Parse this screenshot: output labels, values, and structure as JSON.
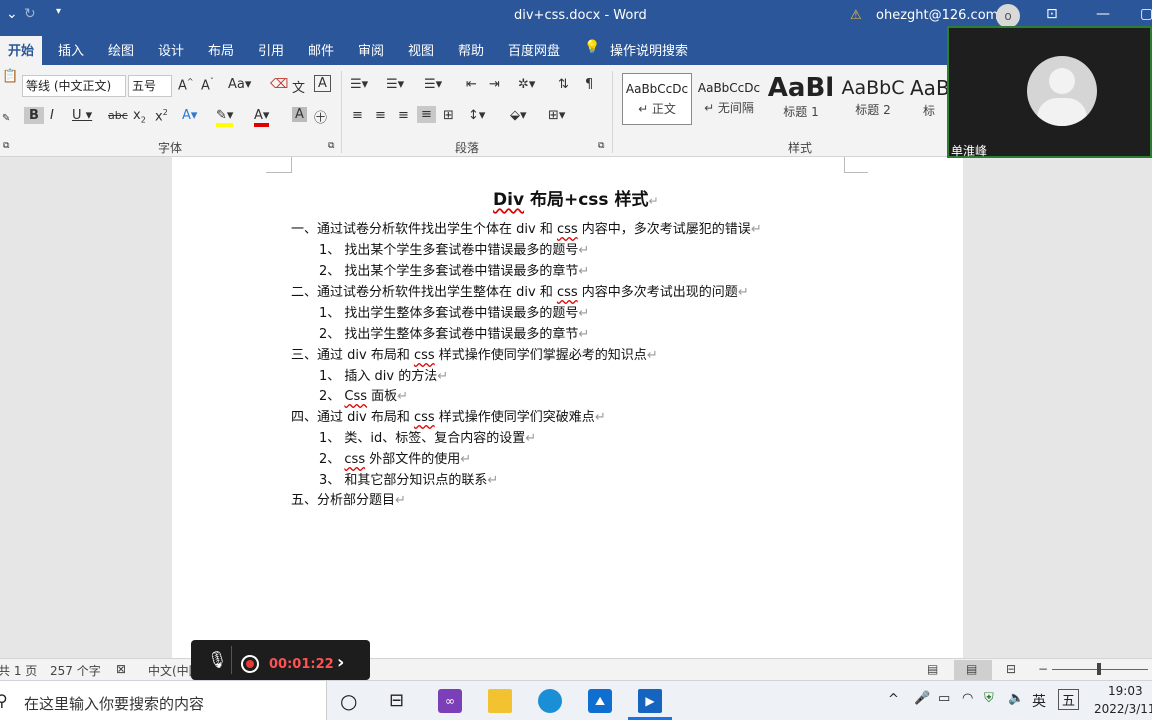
{
  "window": {
    "title": "div+css.docx  -  Word",
    "warning_icon": "warning-icon",
    "account": "ohezght@126.com",
    "avatar_initial": "o"
  },
  "tabs": [
    "开始",
    "插入",
    "绘图",
    "设计",
    "布局",
    "引用",
    "邮件",
    "审阅",
    "视图",
    "帮助",
    "百度网盘",
    "操作说明搜索"
  ],
  "ribbon": {
    "font": {
      "family": "等线 (中文正文)",
      "size": "五号",
      "label": "字体"
    },
    "paragraph": {
      "label": "段落"
    },
    "styles": {
      "label": "样式",
      "items": [
        {
          "preview": "AaBbCcDc",
          "name": "↵ 正文"
        },
        {
          "preview": "AaBbCcDc",
          "name": "↵ 无间隔"
        },
        {
          "preview": "AaBl",
          "name": "标题 1"
        },
        {
          "preview": "AaBbC",
          "name": "标题 2"
        },
        {
          "preview": "AaBl",
          "name": "标"
        }
      ]
    }
  },
  "document": {
    "title_part1": "Div",
    "title_part2": " 布局+",
    "title_part3": "css",
    "title_part4": " 样式",
    "lines": [
      {
        "a": "一、通过试卷分析软件找出学生个体在 div 和 ",
        "s": "css",
        "b": " 内容中，多次考试屡犯的错误"
      },
      {
        "a": "1、 找出某个学生多套试卷中错误最多的题号",
        "s": "",
        "b": ""
      },
      {
        "a": "2、 找出某个学生多套试卷中错误最多的章节",
        "s": "",
        "b": ""
      },
      {
        "a": "二、通过试卷分析软件找出学生整体在 div 和 ",
        "s": "css",
        "b": " 内容中多次考试出现的问题"
      },
      {
        "a": "1、 找出学生整体多套试卷中错误最多的题号",
        "s": "",
        "b": ""
      },
      {
        "a": "2、 找出学生整体多套试卷中错误最多的章节",
        "s": "",
        "b": ""
      },
      {
        "a": "三、通过 div 布局和 ",
        "s": "css",
        "b": " 样式操作使同学们掌握必考的知识点"
      },
      {
        "a": "1、 插入 div 的方法",
        "s": "",
        "b": ""
      },
      {
        "a": "2、 ",
        "s": "Css",
        "b": " 面板"
      },
      {
        "a": "四、通过 div 布局和 ",
        "s": "css",
        "b": " 样式操作使同学们突破难点"
      },
      {
        "a": "1、 类、id、标签、复合内容的设置",
        "s": "",
        "b": ""
      },
      {
        "a": "2、 ",
        "s": "css",
        "b": " 外部文件的使用"
      },
      {
        "a": "3、 和其它部分知识点的联系",
        "s": "",
        "b": ""
      },
      {
        "a": "五、分析部分题目",
        "s": "",
        "b": ""
      }
    ],
    "para_mark": "↵"
  },
  "status": {
    "page": "共 1 页",
    "words": "257 个字",
    "lang": "中文(中国)"
  },
  "recorder": {
    "time": "00:01:22"
  },
  "taskbar": {
    "search_placeholder": "在这里输入你要搜索的内容",
    "time": "19:03",
    "date": "2022/3/11",
    "ime1": "英",
    "ime2": "五"
  },
  "webcam": {
    "name": "单淮峰"
  },
  "colors": {
    "word_blue": "#2b579a",
    "font_red": "#e00000",
    "highlight": "#ffff00"
  }
}
